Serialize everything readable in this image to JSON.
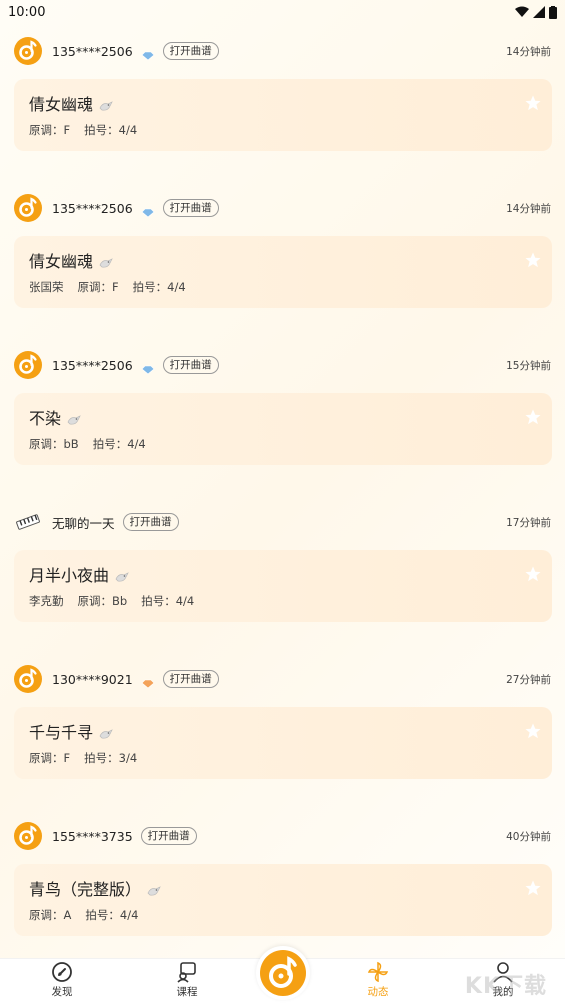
{
  "status_bar": {
    "time": "10:00"
  },
  "posts": [
    {
      "avatar": "music-disc-icon",
      "username": "135****2506",
      "badge": "blue-badge-icon",
      "tag": "打开曲谱",
      "time": "14分钟前",
      "title": "倩女幽魂",
      "artist": "",
      "key": "原调：F",
      "beat": "拍号：4/4"
    },
    {
      "avatar": "music-disc-icon",
      "username": "135****2506",
      "badge": "blue-badge-icon",
      "tag": "打开曲谱",
      "time": "14分钟前",
      "title": "倩女幽魂",
      "artist": "张国荣",
      "key": "原调：F",
      "beat": "拍号：4/4"
    },
    {
      "avatar": "music-disc-icon",
      "username": "135****2506",
      "badge": "blue-badge-icon",
      "tag": "打开曲谱",
      "time": "15分钟前",
      "title": "不染",
      "artist": "",
      "key": "原调：bB",
      "beat": "拍号：4/4"
    },
    {
      "avatar": "keyboard-icon",
      "username": "无聊的一天",
      "badge": "",
      "tag": "打开曲谱",
      "time": "17分钟前",
      "title": "月半小夜曲",
      "artist": "李克勤",
      "key": "原调：Bb",
      "beat": "拍号：4/4"
    },
    {
      "avatar": "music-disc-icon",
      "username": "130****9021",
      "badge": "orange-badge-icon",
      "tag": "打开曲谱",
      "time": "27分钟前",
      "title": "千与千寻",
      "artist": "",
      "key": "原调：F",
      "beat": "拍号：3/4"
    },
    {
      "avatar": "music-disc-icon",
      "username": "155****3735",
      "badge": "",
      "tag": "打开曲谱",
      "time": "40分钟前",
      "title": "青鸟（完整版）",
      "artist": "",
      "key": "原调：A",
      "beat": "拍号：4/4"
    }
  ],
  "tab_bar": {
    "tabs": [
      {
        "label": "发现",
        "icon": "discover-icon"
      },
      {
        "label": "课程",
        "icon": "course-icon"
      },
      {
        "label": "动态",
        "icon": "pinwheel-icon",
        "active": true
      },
      {
        "label": "我的",
        "icon": "profile-icon"
      }
    ],
    "center_icon": "music-disc-icon"
  },
  "watermark": "KK下载",
  "colors": {
    "accent": "#f5a013",
    "card_bg": "#fff1de",
    "badge_blue": "#7fb8e8",
    "badge_orange": "#f4a35a"
  }
}
